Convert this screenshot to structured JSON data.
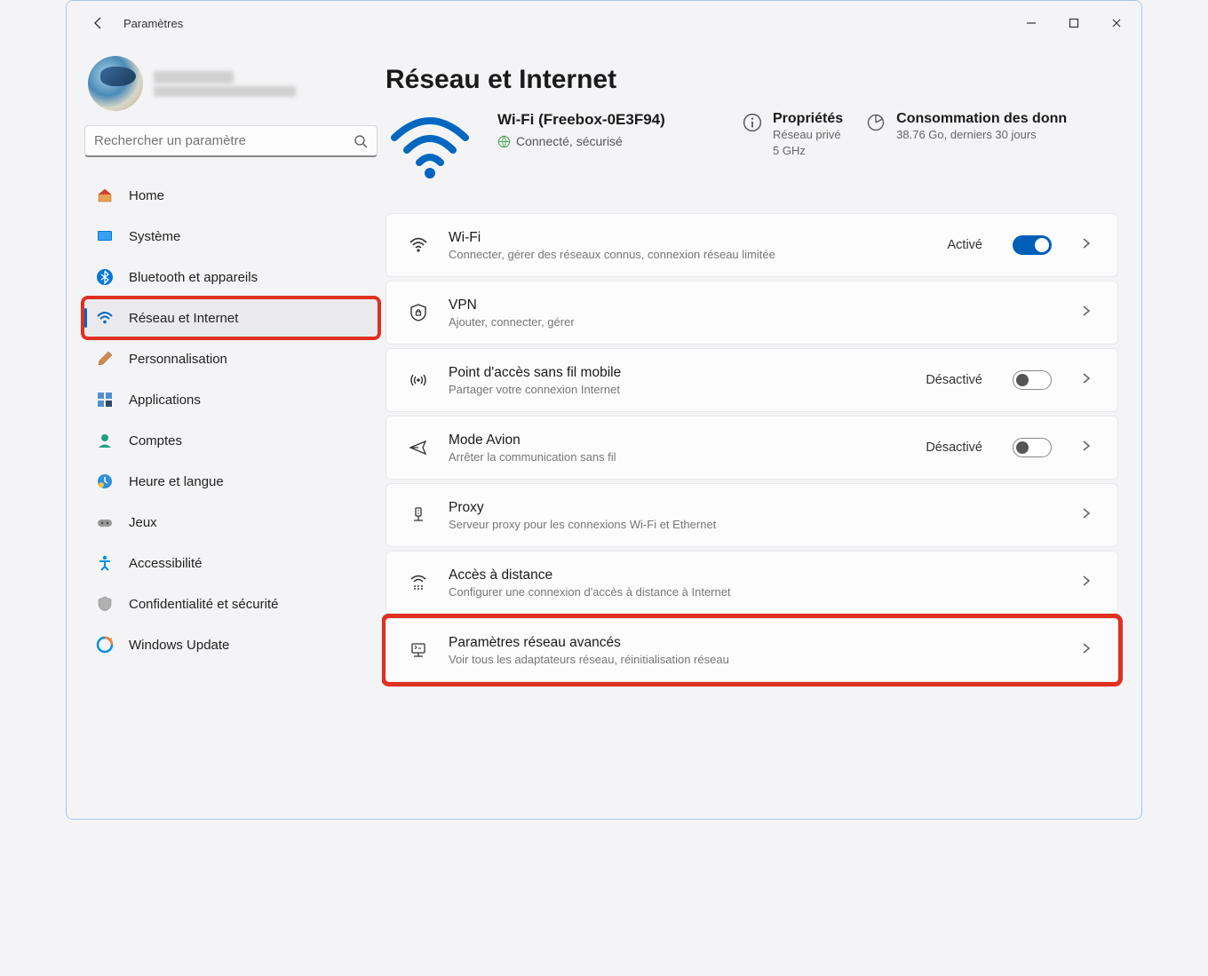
{
  "window": {
    "title": "Paramètres"
  },
  "user": {
    "name_redacted": true
  },
  "search": {
    "placeholder": "Rechercher un paramètre"
  },
  "sidebar": {
    "items": [
      {
        "label": "Home",
        "icon": "home",
        "selected": false
      },
      {
        "label": "Système",
        "icon": "system",
        "selected": false
      },
      {
        "label": "Bluetooth et appareils",
        "icon": "bluetooth",
        "selected": false
      },
      {
        "label": "Réseau et Internet",
        "icon": "wifi",
        "selected": true,
        "highlighted": true
      },
      {
        "label": "Personnalisation",
        "icon": "brush",
        "selected": false
      },
      {
        "label": "Applications",
        "icon": "apps",
        "selected": false
      },
      {
        "label": "Comptes",
        "icon": "user",
        "selected": false
      },
      {
        "label": "Heure et langue",
        "icon": "time",
        "selected": false
      },
      {
        "label": "Jeux",
        "icon": "gamepad",
        "selected": false
      },
      {
        "label": "Accessibilité",
        "icon": "accessibility",
        "selected": false
      },
      {
        "label": "Confidentialité et sécurité",
        "icon": "shield",
        "selected": false
      },
      {
        "label": "Windows Update",
        "icon": "update",
        "selected": false
      }
    ]
  },
  "page": {
    "title": "Réseau et Internet"
  },
  "hero": {
    "main": {
      "title": "Wi-Fi (Freebox-0E3F94)",
      "status": "Connecté, sécurisé"
    },
    "properties": {
      "title": "Propriétés",
      "line1": "Réseau privé",
      "line2": "5 GHz"
    },
    "usage": {
      "title": "Consommation des donn",
      "sub": "38.76 Go, derniers 30 jours"
    }
  },
  "cards": [
    {
      "id": "wifi",
      "title": "Wi-Fi",
      "sub": "Connecter, gérer des réseaux connus, connexion réseau limitée",
      "state": "Activé",
      "toggle": "on"
    },
    {
      "id": "vpn",
      "title": "VPN",
      "sub": "Ajouter, connecter, gérer"
    },
    {
      "id": "hotspot",
      "title": "Point d'accès sans fil mobile",
      "sub": "Partager votre connexion Internet",
      "state": "Désactivé",
      "toggle": "off"
    },
    {
      "id": "airplane",
      "title": "Mode Avion",
      "sub": "Arrêter la communication sans fil",
      "state": "Désactivé",
      "toggle": "off"
    },
    {
      "id": "proxy",
      "title": "Proxy",
      "sub": "Serveur proxy pour les connexions Wi-Fi et Ethernet"
    },
    {
      "id": "dialup",
      "title": "Accès à distance",
      "sub": "Configurer une connexion d'accès à distance à Internet"
    },
    {
      "id": "advanced",
      "title": "Paramètres réseau avancés",
      "sub": "Voir tous les adaptateurs réseau, réinitialisation réseau",
      "highlighted": true
    }
  ]
}
